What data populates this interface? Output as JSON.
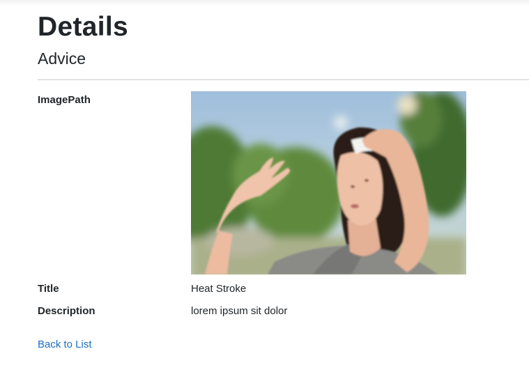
{
  "page": {
    "heading": "Details",
    "subheading": "Advice"
  },
  "fields": {
    "image_label": "ImagePath",
    "title_label": "Title",
    "title_value": "Heat Stroke",
    "description_label": "Description",
    "description_value": "lorem ipsum sit dolor"
  },
  "image": {
    "icon": "photo-woman-heat",
    "alt": ""
  },
  "links": {
    "back": "Back to List"
  },
  "colors": {
    "link": "#1b6ec2",
    "text": "#212529",
    "divider": "#c9c9c9"
  }
}
